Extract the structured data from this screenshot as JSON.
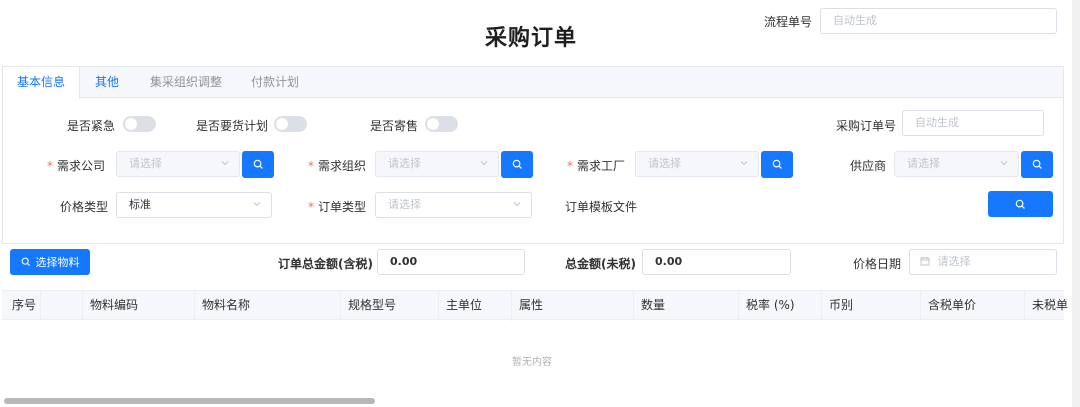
{
  "title": "采购订单",
  "header": {
    "flow_label": "流程单号",
    "flow_placeholder": "自动生成"
  },
  "tabs": [
    {
      "label": "基本信息"
    },
    {
      "label": "其他"
    },
    {
      "label": "集采组织调整"
    },
    {
      "label": "付款计划"
    }
  ],
  "form": {
    "urgent_label": "是否紧急",
    "plan_label": "是否要货计划",
    "consign_label": "是否寄售",
    "po_number_label": "采购订单号",
    "po_number_placeholder": "自动生成",
    "company_label": "需求公司",
    "company_placeholder": "请选择",
    "org_label": "需求组织",
    "org_placeholder": "请选择",
    "factory_label": "需求工厂",
    "factory_placeholder": "请选择",
    "supplier_label": "供应商",
    "supplier_placeholder": "请选择",
    "price_type_label": "价格类型",
    "price_type_value": "标准",
    "order_type_label": "订单类型",
    "order_type_placeholder": "请选择",
    "template_label": "订单模板文件",
    "required_mark": "*"
  },
  "summary": {
    "select_material_label": "选择物料",
    "total_tax_label": "订单总金额(含税)",
    "total_tax_value": "0.00",
    "total_notax_label": "总金额(未税)",
    "total_notax_value": "0.00",
    "price_date_label": "价格日期",
    "price_date_placeholder": "请选择"
  },
  "table": {
    "columns": [
      "序号",
      "物料编码",
      "物料名称",
      "规格型号",
      "主单位",
      "属性",
      "数量",
      "税率 (%)",
      "币别",
      "含税单价",
      "未税单"
    ],
    "empty_text": "暂无内容"
  },
  "colors": {
    "primary": "#1677ff",
    "required": "#f56c6c"
  }
}
